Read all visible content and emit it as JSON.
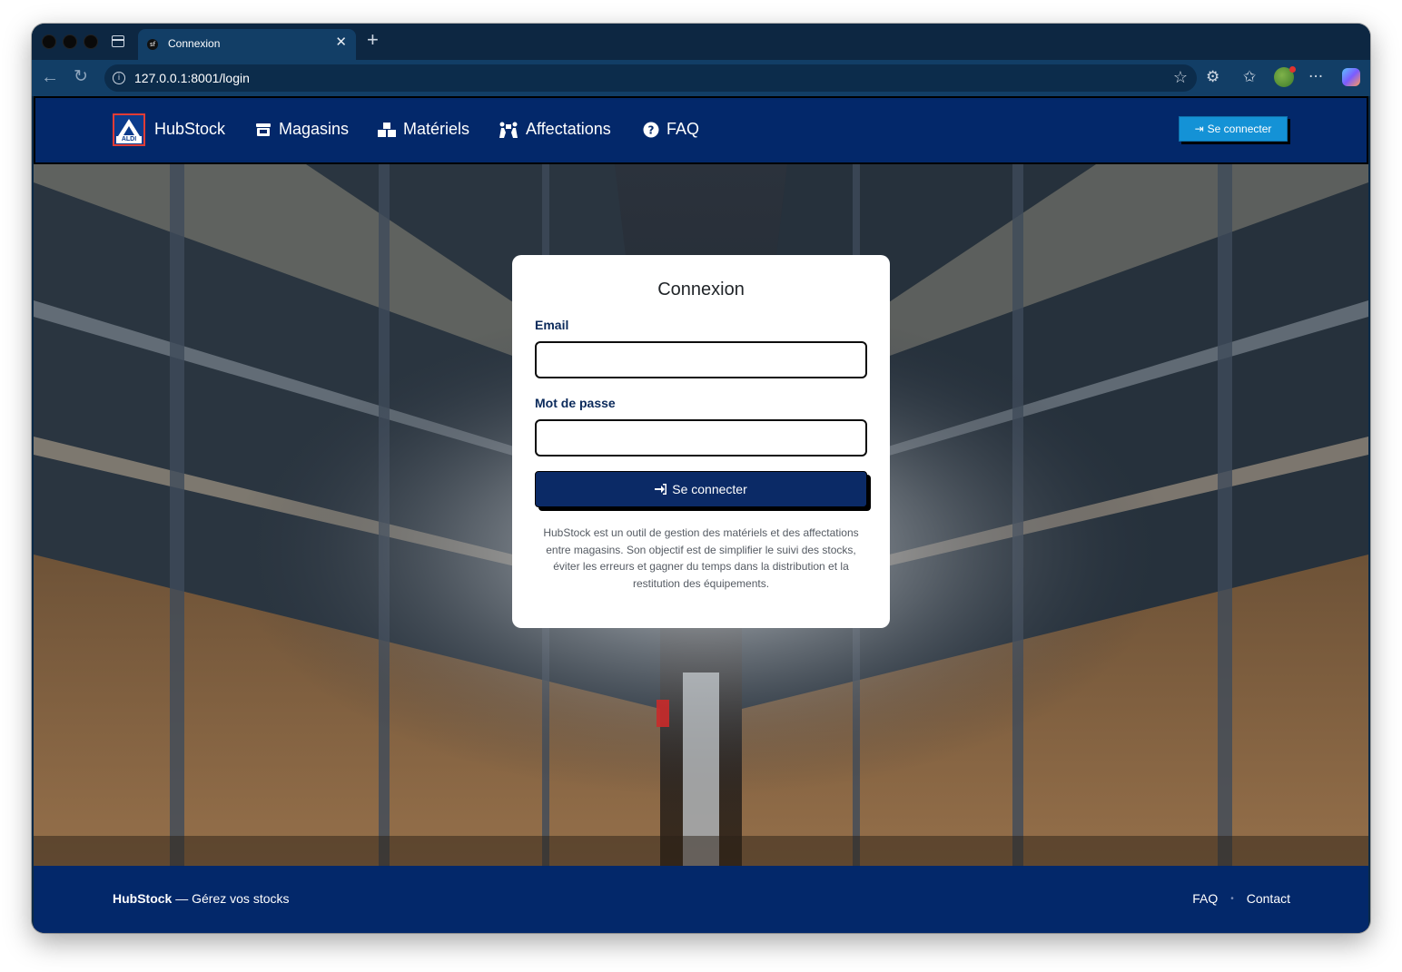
{
  "browser": {
    "tab_title": "Connexion",
    "tab_favicon": "sf",
    "url": "127.0.0.1:8001/login"
  },
  "navbar": {
    "brand": "HubStock",
    "logo_text": "ALDI",
    "links": [
      {
        "label": "Magasins",
        "icon": "store-icon"
      },
      {
        "label": "Matériels",
        "icon": "boxes-icon"
      },
      {
        "label": "Affectations",
        "icon": "people-carry-icon"
      },
      {
        "label": "FAQ",
        "icon": "question-circle-icon"
      }
    ],
    "login_button": "Se connecter"
  },
  "login_card": {
    "title": "Connexion",
    "email_label": "Email",
    "email_value": "",
    "password_label": "Mot de passe",
    "password_value": "",
    "submit_label": "Se connecter",
    "description": "HubStock est un outil de gestion des matériels et des affectations entre magasins. Son objectif est de simplifier le suivi des stocks, éviter les erreurs et gagner du temps dans la distribution et la restitution des équipements."
  },
  "footer": {
    "brand": "HubStock",
    "tagline": " — Gérez vos stocks",
    "links": [
      "FAQ",
      "Contact"
    ]
  },
  "colors": {
    "navbar_bg": "#03286a",
    "primary_button": "#0b2a66",
    "top_button": "#1492d6",
    "label": "#0b2a5b"
  }
}
